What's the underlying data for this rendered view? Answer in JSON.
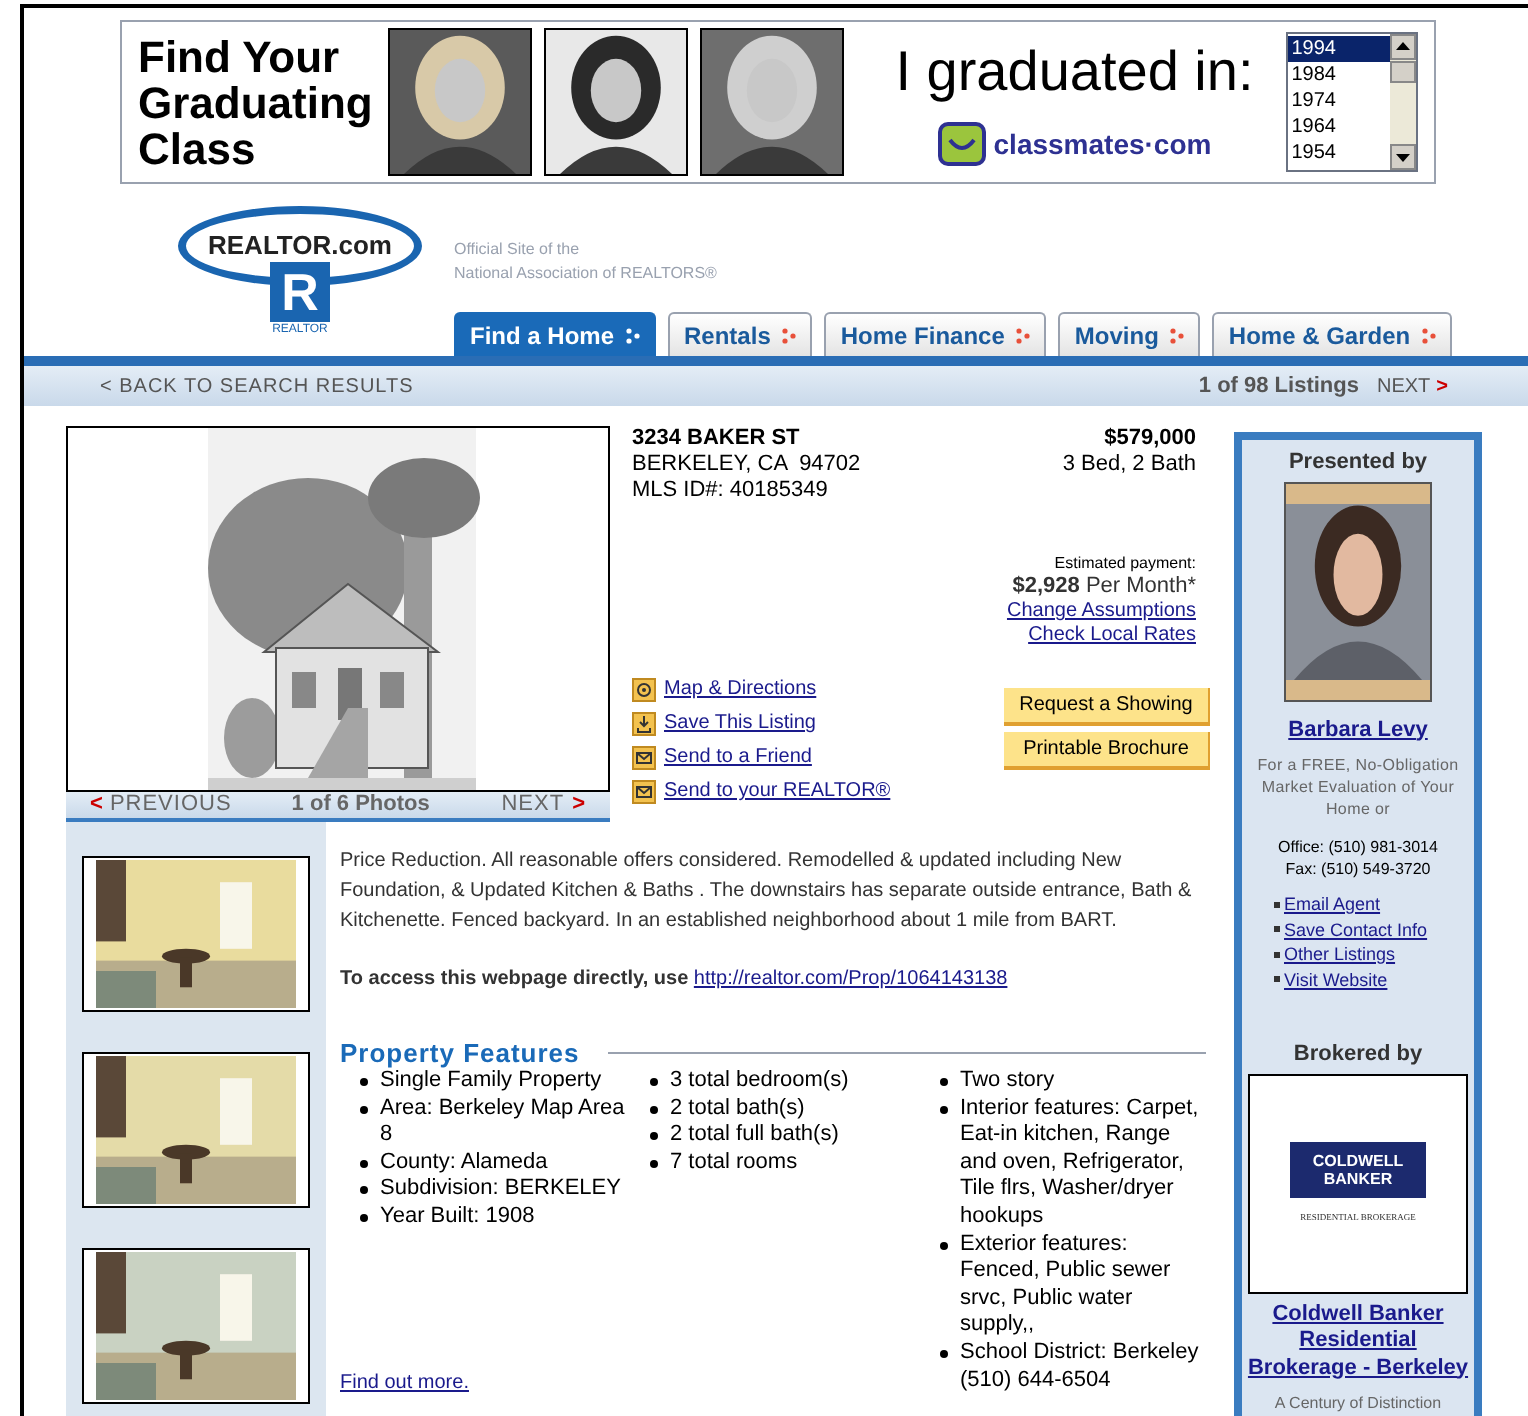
{
  "ad_banner": {
    "headline": "Find Your Graduating Class",
    "photos": [
      {
        "kind": "picture"
      },
      {
        "kind": "picture"
      },
      {
        "kind": "picture"
      }
    ],
    "prompt": "I graduated in:",
    "logo": "classmates·com",
    "years": [
      {
        "label": "1994",
        "selected": true
      },
      {
        "label": "1984",
        "selected": false
      },
      {
        "label": "1974",
        "selected": false
      },
      {
        "label": "1964",
        "selected": false
      },
      {
        "label": "1954",
        "selected": false
      }
    ]
  },
  "header": {
    "logo_text": "REALTOR.com",
    "logo_mark": "R",
    "logo_caption": "REALTOR",
    "tagline": [
      "Official Site of the",
      "National Association of REALTORS®"
    ]
  },
  "tabs": [
    {
      "label": "Find a Home",
      "selected": true
    },
    {
      "label": "Rentals",
      "selected": false
    },
    {
      "label": "Home Finance",
      "selected": false
    },
    {
      "label": "Moving",
      "selected": false
    },
    {
      "label": "Home & Garden",
      "selected": false
    }
  ],
  "nav_bar": {
    "back": "< BACK TO SEARCH RESULTS",
    "position": "1 of 98 Listings",
    "next": "NEXT",
    "next_arrow": ">"
  },
  "photo_viewer": {
    "previous_arrow": "<",
    "previous": "PREVIOUS",
    "counter": "1 of 6 Photos",
    "next": "NEXT",
    "next_arrow": ">"
  },
  "thumbnails": [
    {
      "kind": "picture"
    },
    {
      "kind": "picture"
    },
    {
      "kind": "picture"
    }
  ],
  "listing": {
    "address": "3234 BAKER ST",
    "city": "BERKELEY, CA  94702",
    "mls": "MLS ID#: 40185349",
    "price": "$579,000",
    "beds_baths": "3 Bed, 2 Bath",
    "payment_label": "Estimated payment:",
    "payment": "**$2,928** Per Month*",
    "payment_links": [
      "Change Assumptions",
      "Check Local Rates"
    ]
  },
  "actions": [
    {
      "label": "Map & Directions",
      "kind": "map"
    },
    {
      "label": "Save This Listing",
      "kind": "save"
    },
    {
      "label": "Send to a Friend",
      "kind": "mail"
    },
    {
      "label": "Send to your REALTOR®",
      "kind": "mail"
    }
  ],
  "buttons": [
    "Request a Showing",
    "Printable Brochure"
  ],
  "description": "Price Reduction. All reasonable offers considered. Remodelled & updated including New Foundation, & Updated Kitchen & Baths . The downstairs has separate outside entrance, Bath & Kitchenette. Fenced backyard. In an established neighborhood about 1 mile from BART.",
  "direct_access": {
    "label": "To access this webpage directly, use",
    "url": "http://realtor.com/Prop/1064143138"
  },
  "features": {
    "title": "Property Features",
    "columns": [
      [
        "Single Family Property",
        "Area: Berkeley Map Area 8",
        "County: Alameda",
        "Subdivision: BERKELEY",
        "Year Built: 1908"
      ],
      [
        "3 total bedroom(s)",
        "2 total bath(s)",
        "2 total full bath(s)",
        "7 total rooms"
      ],
      [
        "Two story",
        "Interior features: Carpet, Eat-in kitchen, Range and oven, Refrigerator, Tile flrs, Washer/dryer hookups",
        "Exterior features: Fenced, Public sewer srvc, Public water supply,,",
        "School District: Berkeley (510) 644-6504"
      ]
    ]
  },
  "find_more": "Find out more.",
  "agent": {
    "heading": "Presented by",
    "name": "Barbara Levy",
    "pitch": "For a FREE, No-Obligation Market Evaluation of Your Home or",
    "office": "Office: (510) 981-3014",
    "fax": "Fax: (510) 549-3720",
    "links": [
      "Email Agent",
      "Save Contact Info",
      "Other Listings",
      "Visit Website"
    ]
  },
  "broker": {
    "heading": "Brokered by",
    "logo": "COLDWELL BANKER",
    "logo_caption": "RESIDENTIAL BROKERAGE",
    "name": "Coldwell Banker Residential Brokerage - Berkeley",
    "tagline": "A Century of Distinction"
  }
}
